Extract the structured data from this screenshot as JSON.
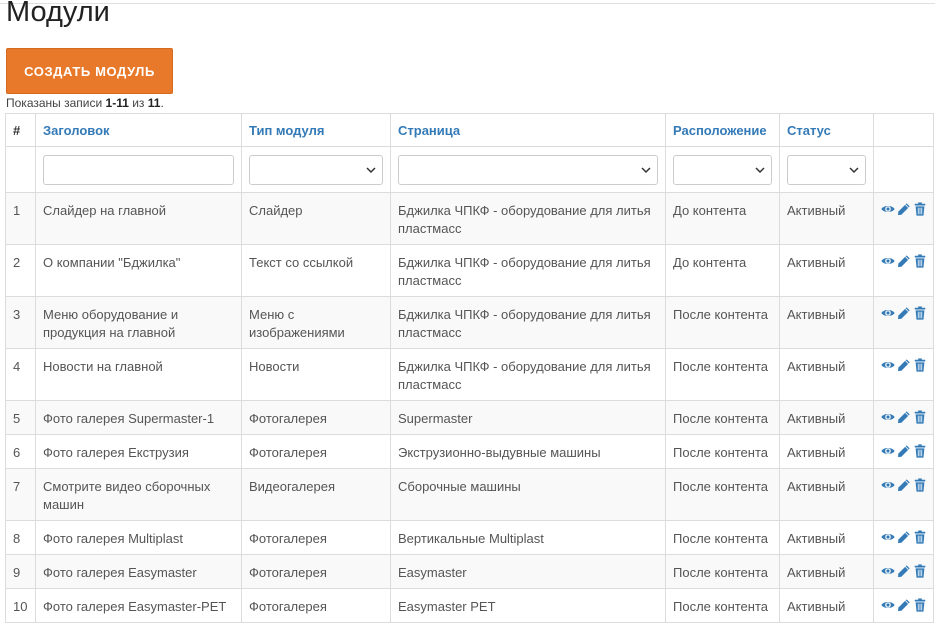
{
  "page": {
    "title": "Модули",
    "create_button": "СОЗДАТЬ МОДУЛЬ",
    "summary": {
      "prefix": "Показаны записи ",
      "range": "1-11",
      "middle": " из ",
      "total": "11",
      "suffix": "."
    }
  },
  "table": {
    "columns": [
      "#",
      "Заголовок",
      "Тип модуля",
      "Страница",
      "Расположение",
      "Статус"
    ],
    "rows": [
      {
        "num": "1",
        "title": "Слайдер на главной",
        "type": "Слайдер",
        "page": "Бджилка ЧПКФ - оборудование для литья пластмасс",
        "position": "До контента",
        "status": "Активный"
      },
      {
        "num": "2",
        "title": "О компании \"Бджилка\"",
        "type": "Текст со ссылкой",
        "page": "Бджилка ЧПКФ - оборудование для литья пластмасс",
        "position": "До контента",
        "status": "Активный"
      },
      {
        "num": "3",
        "title": "Меню оборудование и продукция на главной",
        "type": "Меню с изображениями",
        "page": "Бджилка ЧПКФ - оборудование для литья пластмасс",
        "position": "После контента",
        "status": "Активный"
      },
      {
        "num": "4",
        "title": "Новости на главной",
        "type": "Новости",
        "page": "Бджилка ЧПКФ - оборудование для литья пластмасс",
        "position": "После контента",
        "status": "Активный"
      },
      {
        "num": "5",
        "title": "Фото галерея Supermaster-1",
        "type": "Фотогалерея",
        "page": "Supermaster",
        "position": "После контента",
        "status": "Активный"
      },
      {
        "num": "6",
        "title": "Фото галерея Екструзия",
        "type": "Фотогалерея",
        "page": "Экструзионно-выдувные машины",
        "position": "После контента",
        "status": "Активный"
      },
      {
        "num": "7",
        "title": "Смотрите видео сборочных машин",
        "type": "Видеогалерея",
        "page": "Сборочные машины",
        "position": "После контента",
        "status": "Активный"
      },
      {
        "num": "8",
        "title": "Фото галерея Multiplast",
        "type": "Фотогалерея",
        "page": "Вертикальные Multiplast",
        "position": "После контента",
        "status": "Активный"
      },
      {
        "num": "9",
        "title": "Фото галерея Easymaster",
        "type": "Фотогалерея",
        "page": "Easymaster",
        "position": "После контента",
        "status": "Активный"
      },
      {
        "num": "10",
        "title": "Фото галерея Easymaster-PET",
        "type": "Фотогалерея",
        "page": "Easymaster PET",
        "position": "После контента",
        "status": "Активный"
      }
    ]
  },
  "icons": {
    "view": "eye-icon",
    "edit": "pencil-icon",
    "delete": "trash-icon"
  },
  "colors": {
    "accent": "#e8792b",
    "link": "#337ab7"
  }
}
